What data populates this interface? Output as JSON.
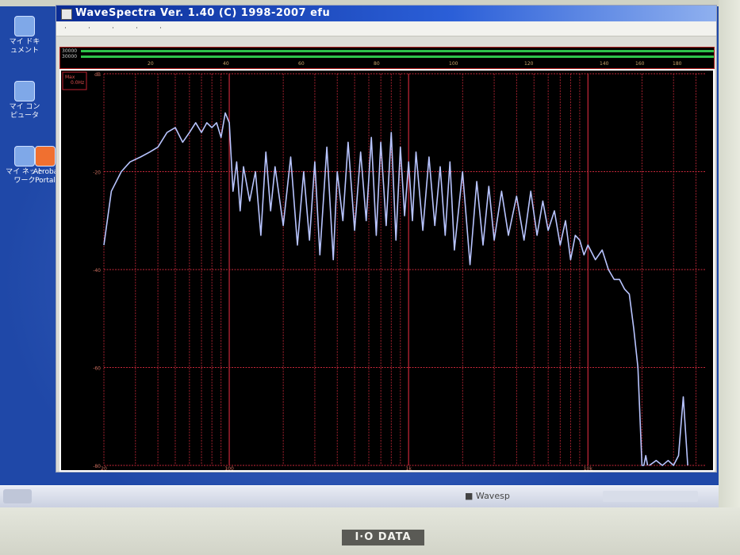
{
  "window": {
    "title": "WaveSpectra  Ver. 1.40  (C) 1998-2007 efu",
    "menu_items": [
      "·",
      "·",
      "·",
      "·",
      "·"
    ]
  },
  "desktop": {
    "icons": [
      {
        "label": "マイ ドキ\nュメント"
      },
      {
        "label": "マイ コン\nピュータ"
      },
      {
        "label": "マイ ネット\nワーク"
      },
      {
        "label": "Acrobat\nPortal"
      }
    ]
  },
  "taskbar": {
    "active_item": "Wavesp"
  },
  "meter": {
    "left_label": "30000",
    "right_label": "30000",
    "ticks": [
      "20",
      "40",
      "60",
      "80",
      "100",
      "120",
      "140",
      "160",
      "180"
    ],
    "level_color": "#2ec24a"
  },
  "plot_overlay": {
    "mode": "Max",
    "freq": "0.0Hz"
  },
  "monitor": {
    "brand": "I·O DATA"
  },
  "chart_data": {
    "type": "line",
    "title": "",
    "xlabel": "",
    "ylabel": "dB",
    "x_scale": "log",
    "xlim": [
      20,
      45000
    ],
    "ylim": [
      -80,
      0
    ],
    "x_tick_labels": [
      "20",
      "100",
      "1k",
      "10k"
    ],
    "y_tick_labels": [
      "dB",
      "-20",
      "-40",
      "-60",
      "-80"
    ],
    "grid": true,
    "line_color": "#b8c4ff",
    "grid_color": "#c8283a",
    "series": [
      {
        "x": [
          20,
          22,
          25,
          28,
          32,
          36,
          40,
          45,
          50,
          55,
          60,
          65,
          70,
          75,
          80,
          85,
          90,
          95,
          100,
          105,
          110,
          115,
          120,
          130,
          140,
          150,
          160,
          170,
          180,
          200,
          220,
          240,
          260,
          280,
          300,
          320,
          350,
          380,
          400,
          430,
          460,
          500,
          540,
          580,
          620,
          660,
          700,
          750,
          800,
          850,
          900,
          950,
          1000,
          1050,
          1100,
          1200,
          1300,
          1400,
          1500,
          1600,
          1700,
          1800,
          2000,
          2200,
          2400,
          2600,
          2800,
          3000,
          3300,
          3600,
          4000,
          4400,
          4800,
          5200,
          5600,
          6000,
          6500,
          7000,
          7500,
          8000,
          8500,
          9000,
          9500,
          10000,
          11000,
          12000,
          13000,
          14000,
          15000,
          16000,
          17000,
          18000,
          19000,
          20000,
          20500,
          21000,
          21500
        ],
        "y": [
          -35,
          -24,
          -20,
          -18,
          -17,
          -16,
          -15,
          -12,
          -11,
          -14,
          -12,
          -10,
          -12,
          -10,
          -11,
          -10,
          -13,
          -8,
          -10,
          -24,
          -18,
          -28,
          -19,
          -26,
          -20,
          -33,
          -16,
          -28,
          -19,
          -31,
          -17,
          -35,
          -20,
          -34,
          -18,
          -37,
          -15,
          -38,
          -20,
          -30,
          -14,
          -32,
          -16,
          -30,
          -13,
          -33,
          -14,
          -31,
          -12,
          -34,
          -15,
          -29,
          -18,
          -30,
          -16,
          -32,
          -17,
          -31,
          -19,
          -33,
          -18,
          -36,
          -20,
          -39,
          -22,
          -35,
          -23,
          -34,
          -24,
          -33,
          -25,
          -34,
          -24,
          -33,
          -26,
          -32,
          -28,
          -35,
          -30,
          -38,
          -33,
          -34,
          -37,
          -35,
          -38,
          -36,
          -40,
          -42,
          -42,
          -44,
          -45,
          -52,
          -60,
          -80,
          -80,
          -78,
          -80
        ]
      },
      {
        "x": [
          22000,
          24000,
          26000,
          28000,
          30000,
          32000,
          34000,
          36000
        ],
        "y": [
          -80,
          -79,
          -80,
          -79,
          -80,
          -78,
          -66,
          -80
        ]
      }
    ]
  }
}
